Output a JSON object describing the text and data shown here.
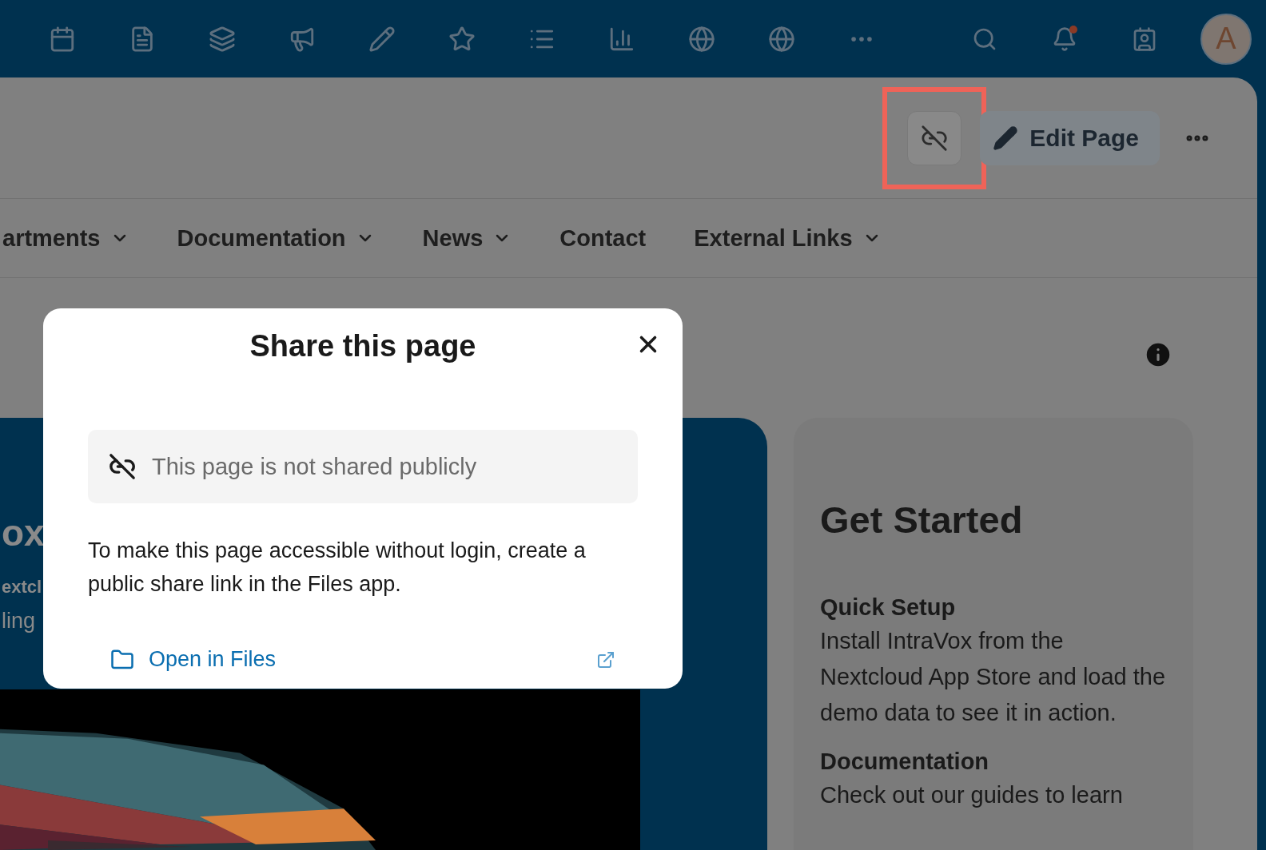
{
  "top_bar": {
    "notifications": {
      "badge": true
    },
    "avatar": {
      "initial": "A"
    }
  },
  "header": {
    "share_button": {
      "highlighted": true
    },
    "edit_button": {
      "label": "Edit Page"
    }
  },
  "nav": [
    {
      "label": "artments",
      "dropdown": true
    },
    {
      "label": "Documentation",
      "dropdown": true
    },
    {
      "label": "News",
      "dropdown": true
    },
    {
      "label": "Contact",
      "dropdown": false
    },
    {
      "label": "External Links",
      "dropdown": true
    }
  ],
  "hero": {
    "title": "ox",
    "subtitle": "extcl",
    "text": "ling"
  },
  "card": {
    "title": "Get Started",
    "sections": [
      {
        "heading": "Quick Setup",
        "text": "Install IntraVox from the Nextcloud App Store and load the demo data to see it in action."
      },
      {
        "heading": "Documentation",
        "text": "Check out our guides to learn"
      }
    ]
  },
  "dialog": {
    "title": "Share this page",
    "status": "This page is not shared publicly",
    "message": "To make this page accessible without login, create a public share link in the Files app.",
    "link": "Open in Files"
  }
}
